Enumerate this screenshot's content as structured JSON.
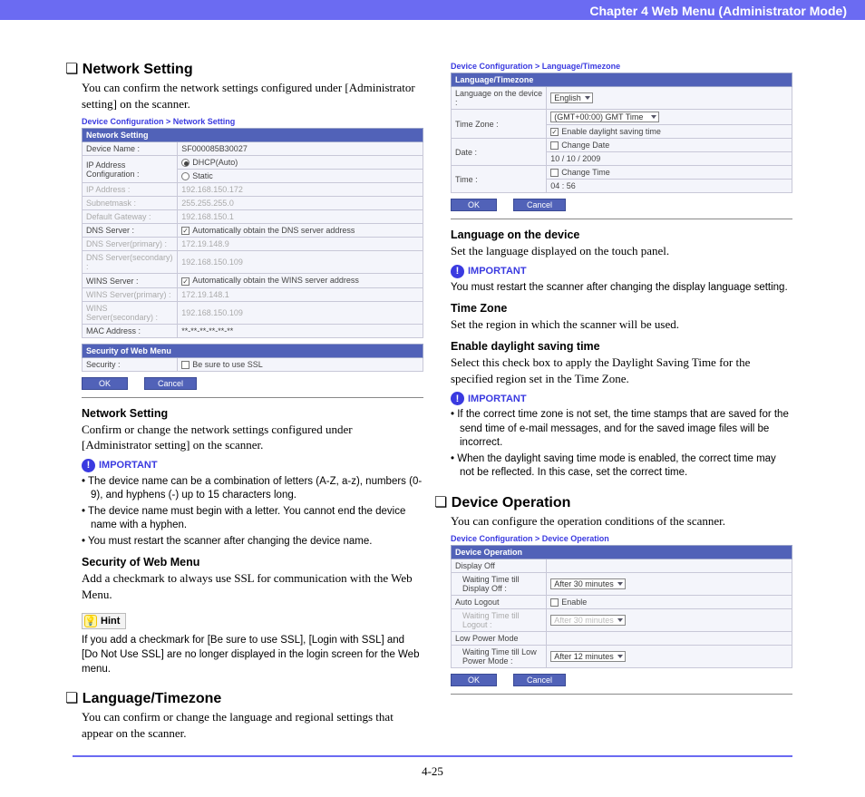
{
  "header": {
    "title": "Chapter 4   Web Menu (Administrator Mode)"
  },
  "page_number": "4-25",
  "left": {
    "network": {
      "title": "Network Setting",
      "intro": "You can confirm the network settings configured under [Administrator setting] on the scanner.",
      "shot": {
        "breadcrumb": "Device Configuration > Network Setting",
        "sec1": "Network Setting",
        "rows": {
          "device_name_lbl": "Device Name :",
          "device_name_val": "SF000085B30027",
          "ip_cfg_lbl": "IP Address Configuration :",
          "ip_cfg_a": "DHCP(Auto)",
          "ip_cfg_b": "Static",
          "ip_addr_lbl": "IP Address :",
          "ip_addr_val": "192.168.150.172",
          "subnet_lbl": "Subnetmask :",
          "subnet_val": "255.255.255.0",
          "gw_lbl": "Default Gateway :",
          "gw_val": "192.168.150.1",
          "dns_lbl": "DNS Server :",
          "dns_auto": "Automatically obtain the DNS server address",
          "dns1_lbl": "DNS Server(primary) :",
          "dns1_val": "172.19.148.9",
          "dns2_lbl": "DNS Server(secondary) :",
          "dns2_val": "192.168.150.109",
          "wins_lbl": "WINS Server :",
          "wins_auto": "Automatically obtain the WINS server address",
          "wins1_lbl": "WINS Server(primary) :",
          "wins1_val": "172.19.148.1",
          "wins2_lbl": "WINS Server(secondary) :",
          "wins2_val": "192.168.150.109",
          "mac_lbl": "MAC Address :",
          "mac_val": "**-**-**-**-**-**"
        },
        "sec2": "Security of Web Menu",
        "sec2_lbl": "Security :",
        "sec2_val": "Be sure to use SSL",
        "ok": "OK",
        "cancel": "Cancel"
      },
      "after_heading": "Network Setting",
      "after_body": "Confirm or change the network settings configured under [Administrator setting] on the scanner.",
      "important_label": "IMPORTANT",
      "important_items": [
        "The device name can be a combination of letters (A-Z, a-z), numbers (0-9), and hyphens (-) up to 15 characters long.",
        "The device name must begin with a letter. You cannot end the device name with a hyphen.",
        "You must restart the scanner after changing the device name."
      ],
      "sec_web_heading": "Security of Web Menu",
      "sec_web_body": "Add a checkmark to always use SSL for communication with the Web Menu.",
      "hint_label": "Hint",
      "hint_body": "If you add a checkmark for [Be sure to use SSL], [Login with SSL] and [Do Not Use SSL] are no longer displayed in the login screen for the Web menu."
    },
    "lang": {
      "title": "Language/Timezone",
      "intro": "You can confirm or change the language and regional settings that appear on the scanner."
    }
  },
  "right": {
    "lang_shot": {
      "breadcrumb": "Device Configuration > Language/Timezone",
      "sec": "Language/Timezone",
      "rows": {
        "lang_lbl": "Language on the device :",
        "lang_val": "English",
        "tz_lbl": "Time Zone :",
        "tz_val": "(GMT+00:00) GMT Time",
        "tz_dst": "Enable daylight saving time",
        "date_lbl": "Date :",
        "date_chk": "Change Date",
        "date_val": "10 / 10 / 2009",
        "time_lbl": "Time :",
        "time_chk": "Change Time",
        "time_val": "04 : 56"
      },
      "ok": "OK",
      "cancel": "Cancel"
    },
    "lang_device_h": "Language on the device",
    "lang_device_b": "Set the language displayed on the touch panel.",
    "important_label": "IMPORTANT",
    "imp1": "You must restart the scanner after changing the display language setting.",
    "tz_h": "Time Zone",
    "tz_b": "Set the region in which the scanner will be used.",
    "dst_h": "Enable daylight saving time",
    "dst_b": "Select this check box to apply the Daylight Saving Time for the specified region set in the Time Zone.",
    "imp2_items": [
      "If the correct time zone is not set, the time stamps that are saved for the send time of e-mail messages, and for the saved image files will be incorrect.",
      "When the daylight saving time mode is enabled, the correct time may not be reflected. In this case, set the correct time."
    ],
    "devop": {
      "title": "Device Operation",
      "intro": "You can configure the operation conditions of the scanner.",
      "shot": {
        "breadcrumb": "Device Configuration > Device Operation",
        "sec": "Device Operation",
        "rows": {
          "disp_lbl": "Display Off",
          "disp_wait_lbl": "Waiting Time till Display Off :",
          "disp_wait_val": "After 30 minutes",
          "auto_lbl": "Auto Logout",
          "auto_chk": "Enable",
          "auto_wait_lbl": "Waiting Time till Logout :",
          "auto_wait_val": "After 30 minutes",
          "low_lbl": "Low Power Mode",
          "low_wait_lbl": "Waiting Time till Low Power Mode :",
          "low_wait_val": "After 12 minutes"
        },
        "ok": "OK",
        "cancel": "Cancel"
      }
    }
  }
}
